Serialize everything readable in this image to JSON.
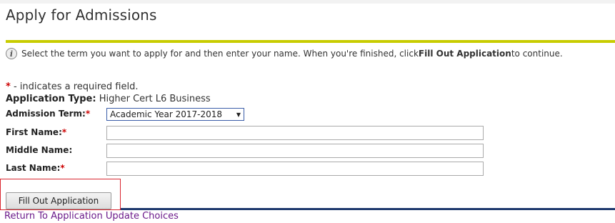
{
  "page": {
    "title": "Apply for Admissions",
    "instructions_prefix": "Select the term you want to apply for and then enter your name. When you're finished, click ",
    "instructions_bold": "Fill Out Application",
    "instructions_suffix": " to continue.",
    "required_star": "*",
    "required_note": " - indicates a required field."
  },
  "application_type": {
    "label": "Application Type:",
    "value": "Higher Cert L6 Business"
  },
  "form": {
    "admission_term": {
      "label": "Admission Term:",
      "selected": "Academic Year 2017-2018"
    },
    "first_name": {
      "label": "First Name:",
      "value": ""
    },
    "middle_name": {
      "label": "Middle Name:",
      "value": ""
    },
    "last_name": {
      "label": "Last Name:",
      "value": ""
    }
  },
  "actions": {
    "submit_label": "Fill Out Application",
    "return_link": "Return To Application Update Choices"
  },
  "colors": {
    "title_rule": "#c8cc00",
    "required_star": "#cc0000",
    "highlight": "#d9252f",
    "link": "#6b1a8a",
    "bottom_rule": "#1f3a6e"
  },
  "icons": {
    "info": "info-icon",
    "dropdown": "chevron-down-icon"
  }
}
